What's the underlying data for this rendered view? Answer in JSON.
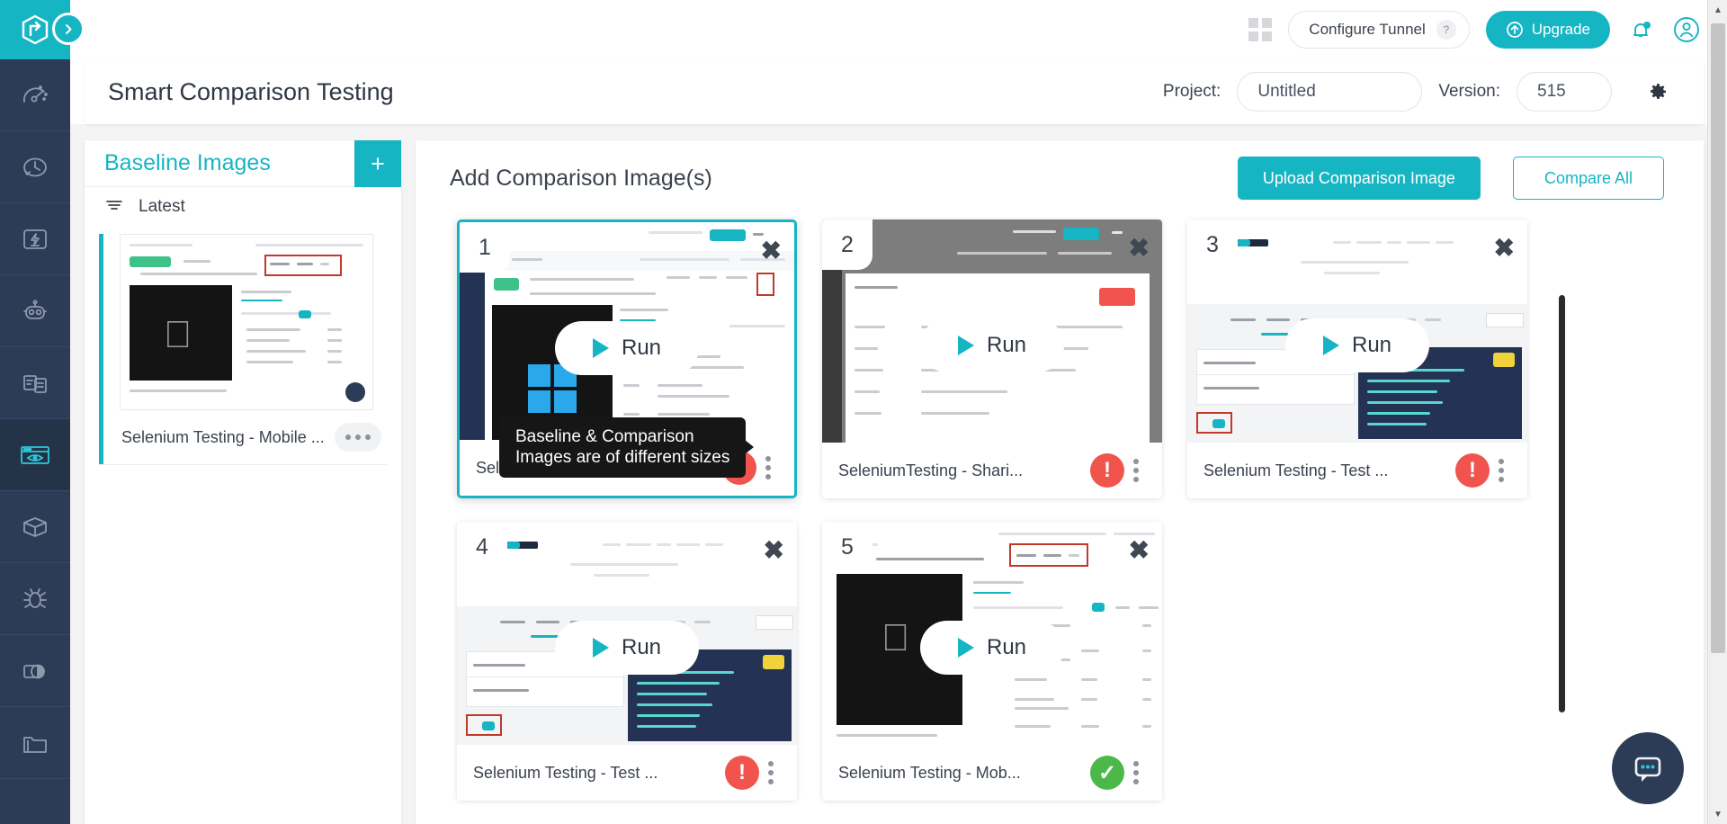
{
  "topbar": {
    "grid_icon": "apps-grid-icon",
    "configure_tunnel": "Configure Tunnel",
    "help_badge": "?",
    "upgrade": "Upgrade",
    "notification_icon": "bell-icon",
    "account_icon": "user-account-icon"
  },
  "header": {
    "title": "Smart Comparison Testing",
    "project_label": "Project:",
    "project_value": "Untitled",
    "version_label": "Version:",
    "version_value": "515",
    "settings_icon": "gear-icon"
  },
  "sidebar": {
    "logo": "lambdatest-logo",
    "expand": "chevron-right-expand-icon",
    "items": [
      {
        "name": "dashboard",
        "icon": "speedometer-icon",
        "active": false
      },
      {
        "name": "timeline",
        "icon": "clock-history-icon",
        "active": false
      },
      {
        "name": "realtime",
        "icon": "lightning-box-icon",
        "active": false
      },
      {
        "name": "automation",
        "icon": "robot-icon",
        "active": false
      },
      {
        "name": "test-logs",
        "icon": "documents-icon",
        "active": false
      },
      {
        "name": "smart-visual-testing",
        "icon": "eye-browser-icon",
        "active": true
      },
      {
        "name": "integrations",
        "icon": "box-package-icon",
        "active": false
      },
      {
        "name": "issue-tracker",
        "icon": "bug-icon",
        "active": false
      },
      {
        "name": "visual-comparison",
        "icon": "contrast-compare-icon",
        "active": false
      },
      {
        "name": "projects",
        "icon": "folder-icon",
        "active": false
      }
    ]
  },
  "baseline": {
    "title": "Baseline Images",
    "add_label": "+",
    "filter_icon": "filter-icon",
    "filter_label": "Latest",
    "cards": [
      {
        "name": "Selenium Testing - Mobile ...",
        "kebab": "more-options-icon"
      }
    ]
  },
  "comparison": {
    "title": "Add Comparison Image(s)",
    "upload_label": "Upload Comparison Image",
    "compare_all_label": "Compare All",
    "run_label": "Run",
    "close_icon": "close-x-icon",
    "tooltip": {
      "line1": "Baseline & Comparison",
      "line2": "Images are of different sizes"
    },
    "cards": [
      {
        "number": "1",
        "name": "Sele...",
        "full_name": "Selenium Testing - ...",
        "status": "error",
        "status_glyph": "!",
        "selected": true,
        "thumb": "windows-dark"
      },
      {
        "number": "2",
        "name": "SeleniumTesting - Shari...",
        "status": "error",
        "status_glyph": "!",
        "selected": false,
        "thumb": "gray-table"
      },
      {
        "number": "3",
        "name": "Selenium Testing - Test ...",
        "status": "error",
        "status_glyph": "!",
        "selected": false,
        "thumb": "docs-code"
      },
      {
        "number": "4",
        "name": "Selenium Testing - Test ...",
        "status": "error",
        "status_glyph": "!",
        "selected": false,
        "thumb": "docs-code"
      },
      {
        "number": "5",
        "name": "Selenium Testing - Mob...",
        "status": "ok",
        "status_glyph": "✓",
        "selected": false,
        "thumb": "apple-dark"
      }
    ]
  },
  "chat": {
    "icon": "chat-bubble-icon"
  },
  "scroll": {
    "up": "▲",
    "down": "▼"
  },
  "colors": {
    "accent": "#16b5c4",
    "rail": "#2d3c56",
    "error": "#f0544c",
    "success": "#4cb849"
  }
}
